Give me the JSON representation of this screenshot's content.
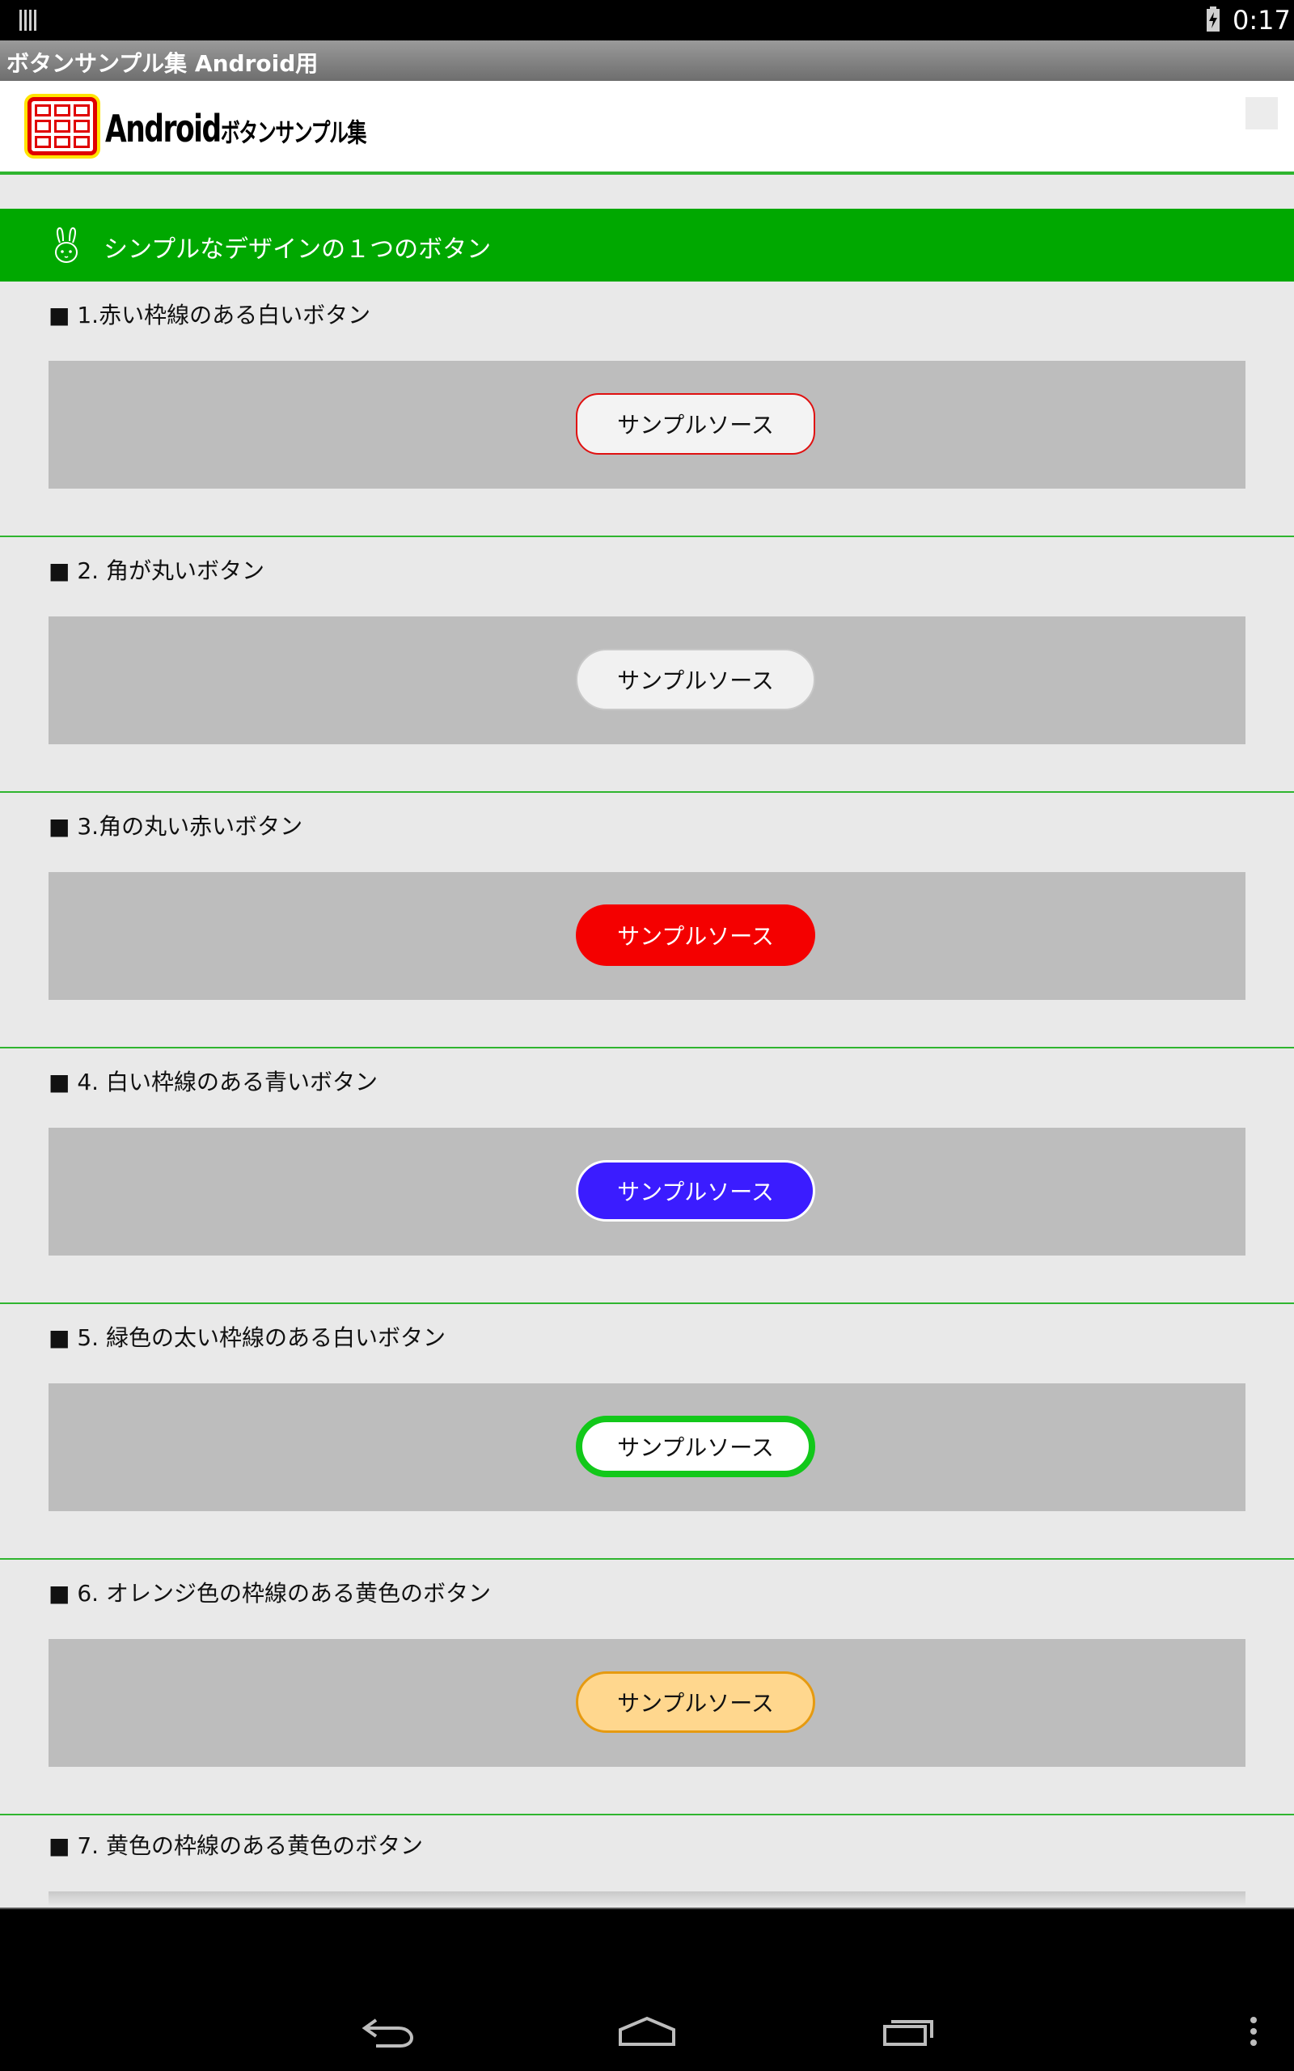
{
  "status_bar": {
    "time": "0:17"
  },
  "app_title": "ボタンサンプル集 Android用",
  "logo": {
    "main": "Android",
    "sub": "ボタンサンプル集"
  },
  "section": {
    "title": "シンプルなデザインの１つのボタン"
  },
  "items": [
    {
      "label": "■ 1.赤い枠線のある白いボタン",
      "button": "サンプルソース"
    },
    {
      "label": "■ 2. 角が丸いボタン",
      "button": "サンプルソース"
    },
    {
      "label": "■ 3.角の丸い赤いボタン",
      "button": "サンプルソース"
    },
    {
      "label": "■ 4. 白い枠線のある青いボタン",
      "button": "サンプルソース"
    },
    {
      "label": "■ 5. 緑色の太い枠線のある白いボタン",
      "button": "サンプルソース"
    },
    {
      "label": "■ 6. オレンジ色の枠線のある黄色のボタン",
      "button": "サンプルソース"
    },
    {
      "label": "■ 7. 黄色の枠線のある黄色のボタン"
    }
  ],
  "colors": {
    "accent_green": "#00a800",
    "button1_border": "#e01010",
    "button3_fill": "#f40000",
    "button4_fill": "#3b1cff",
    "button5_border": "#12c81a",
    "button6_fill": "#ffd78e",
    "button6_border": "#e69a10"
  },
  "icons": {
    "section": "rabbit-icon",
    "nav": [
      "back-icon",
      "home-icon",
      "recent-apps-icon",
      "overflow-menu-icon"
    ]
  }
}
